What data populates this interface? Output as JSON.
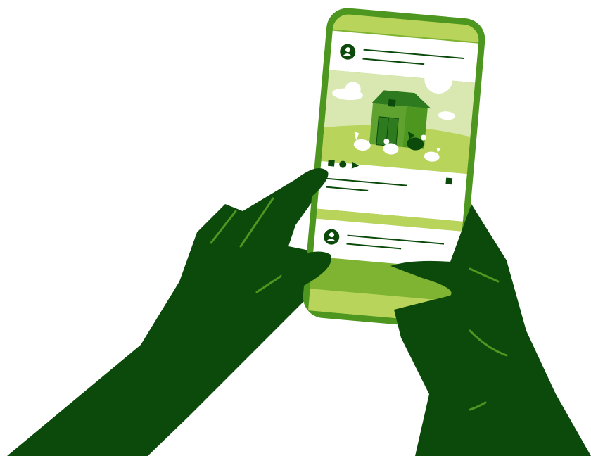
{
  "illustration": {
    "subject": "hands-holding-phone-social-feed",
    "icons": {
      "avatar": "user-avatar-icon",
      "like": "square-reaction-icon",
      "comment": "circle-reaction-icon",
      "share": "play-share-icon",
      "bookmark": "square-bookmark-icon"
    },
    "feed": {
      "post_count_visible": 2,
      "first_post_image": "farm-barn-with-chickens"
    }
  },
  "colors": {
    "background": "#ffffff",
    "hand_dark": "#0b4a0b",
    "phone_frame": "#4d9620",
    "phone_frame_light": "#b9d45a",
    "screen_band": "#b9d45a",
    "screen_header": "#d6e8a8",
    "card_white": "#ffffff",
    "sky": "#d8e8b0",
    "field": "#b9d45a",
    "barn_green": "#5fa22f",
    "barn_dark": "#2e7a1e",
    "text_line": "#0b4a0b"
  }
}
